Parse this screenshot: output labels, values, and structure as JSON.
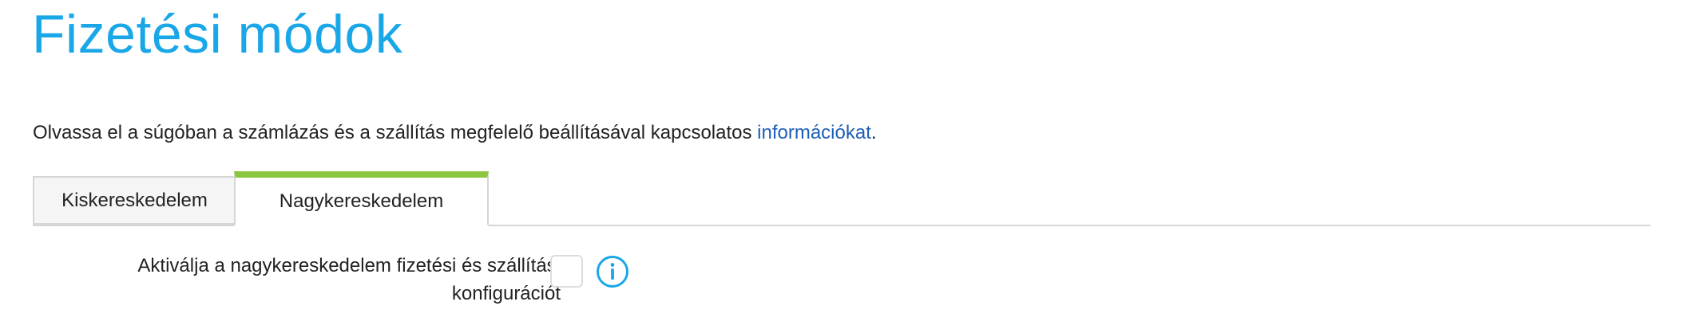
{
  "page": {
    "title": "Fizetési módok"
  },
  "intro": {
    "text": "Olvassa el a súgóban a számlázás és a szállítás megfelelő beállításával kapcsolatos ",
    "link_text": "információkat",
    "suffix": "."
  },
  "tabs": [
    {
      "label": "Kiskereskedelem",
      "active": false
    },
    {
      "label": "Nagykereskedelem",
      "active": true
    }
  ],
  "setting": {
    "label_line1": "Aktiválja a nagykereskedelem fizetési és szállítási",
    "label_line2": "konfigurációt",
    "checked": false,
    "icon": "info-icon"
  },
  "colors": {
    "title": "#1aa7e8",
    "link": "#1d5fb8",
    "active_tab_accent": "#8cc63f",
    "info_icon": "#1aa7e8"
  }
}
